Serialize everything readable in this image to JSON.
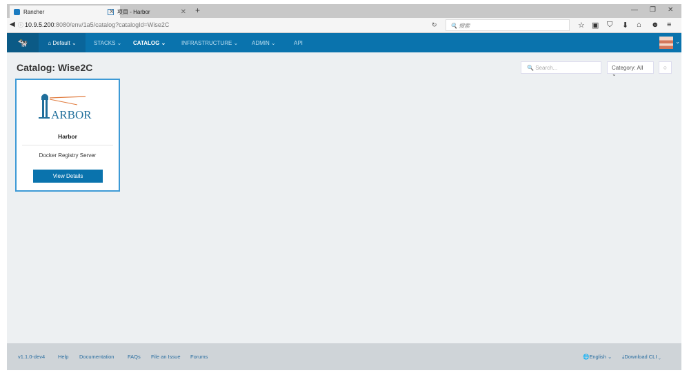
{
  "browser": {
    "tabs": [
      {
        "label": "Rancher",
        "active": true
      },
      {
        "label": "项目 - Harbor",
        "active": false
      }
    ],
    "url_host": "10.9.5.200",
    "url_rest": ":8080/env/1a5/catalog?catalogId=Wise2C",
    "search_placeholder": "搜索"
  },
  "nav": {
    "env": "Default",
    "items": [
      {
        "label": "STACKS"
      },
      {
        "label": "CATALOG",
        "active": true
      },
      {
        "label": "INFRASTRUCTURE"
      },
      {
        "label": "ADMIN"
      },
      {
        "label": "API"
      }
    ]
  },
  "page": {
    "title": "Catalog: Wise2C",
    "search_placeholder": "Search...",
    "category": "Category: All"
  },
  "card": {
    "logo_text": "HARBOR",
    "name": "Harbor",
    "description": "Docker Registry Server",
    "button": "View Details"
  },
  "footer": {
    "links": [
      "v1.1.0-dev4",
      "Help",
      "Documentation",
      "FAQs",
      "File an Issue",
      "Forums"
    ],
    "language": "English",
    "download": "Download CLI"
  },
  "colors": {
    "nav": "#0a73ad",
    "card_border": "#3d9ad6",
    "bg": "#edf0f2"
  }
}
